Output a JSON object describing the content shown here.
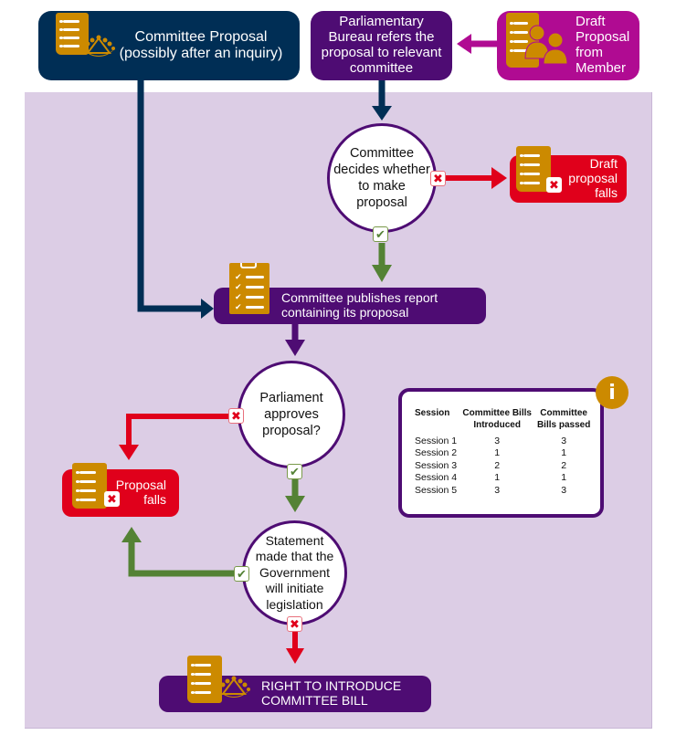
{
  "nodes": {
    "committee_proposal": {
      "label_line1": "Committee Proposal",
      "label_line2": "(possibly after an inquiry)",
      "icon": "document-with-crowd-icon"
    },
    "bureau_refers": {
      "label_line1": "Parliamentary",
      "label_line2": "Bureau refers the",
      "label_line3": "proposal to relevant",
      "label_line4": "committee"
    },
    "draft_from_member": {
      "label_line1": "Draft",
      "label_line2": "Proposal",
      "label_line3": "from",
      "label_line4": "Member",
      "icon": "document-with-members-icon"
    },
    "committee_decides": {
      "label_line1": "Committee",
      "label_line2": "decides whether",
      "label_line3": "to make",
      "label_line4": "proposal"
    },
    "draft_proposal_falls": {
      "label_line1": "Draft",
      "label_line2": "proposal",
      "label_line3": "falls",
      "icon": "document-rejected-icon"
    },
    "publishes_report": {
      "label_line1": "Committee publishes report",
      "label_line2": "containing its proposal",
      "icon": "clipboard-checklist-icon"
    },
    "parliament_approves": {
      "label_line1": "Parliament",
      "label_line2": "approves",
      "label_line3": "proposal?"
    },
    "proposal_falls": {
      "label_line1": "Proposal",
      "label_line2": "falls",
      "icon": "document-rejected-icon"
    },
    "government_statement": {
      "label_line1": "Statement",
      "label_line2": "made that the",
      "label_line3": "Government",
      "label_line4": "will initiate",
      "label_line5": "legislation"
    },
    "right_to_introduce": {
      "label_line1": "RIGHT TO INTRODUCE",
      "label_line2": "COMMITTEE BILL",
      "icon": "document-with-crowd-icon"
    }
  },
  "badges": {
    "yes": "✔",
    "no": "✖"
  },
  "info": {
    "icon_glyph": "i",
    "headers": [
      "Session",
      "Committee Bills Introduced",
      "Committee Bills passed"
    ],
    "header_lines": [
      [
        "Session",
        ""
      ],
      [
        "Committee Bills",
        "Introduced"
      ],
      [
        "Committee",
        "Bills passed"
      ]
    ],
    "rows": [
      [
        "Session 1",
        "3",
        "3"
      ],
      [
        "Session 2",
        "1",
        "1"
      ],
      [
        "Session 3",
        "2",
        "2"
      ],
      [
        "Session 4",
        "1",
        "1"
      ],
      [
        "Session 5",
        "3",
        "3"
      ]
    ]
  },
  "colors": {
    "navy": "#002e55",
    "purple": "#4e0c73",
    "magenta": "#b00b92",
    "red": "#e0001b",
    "green": "#548235",
    "gold": "#cc8a00",
    "panel": "#dccde5"
  }
}
